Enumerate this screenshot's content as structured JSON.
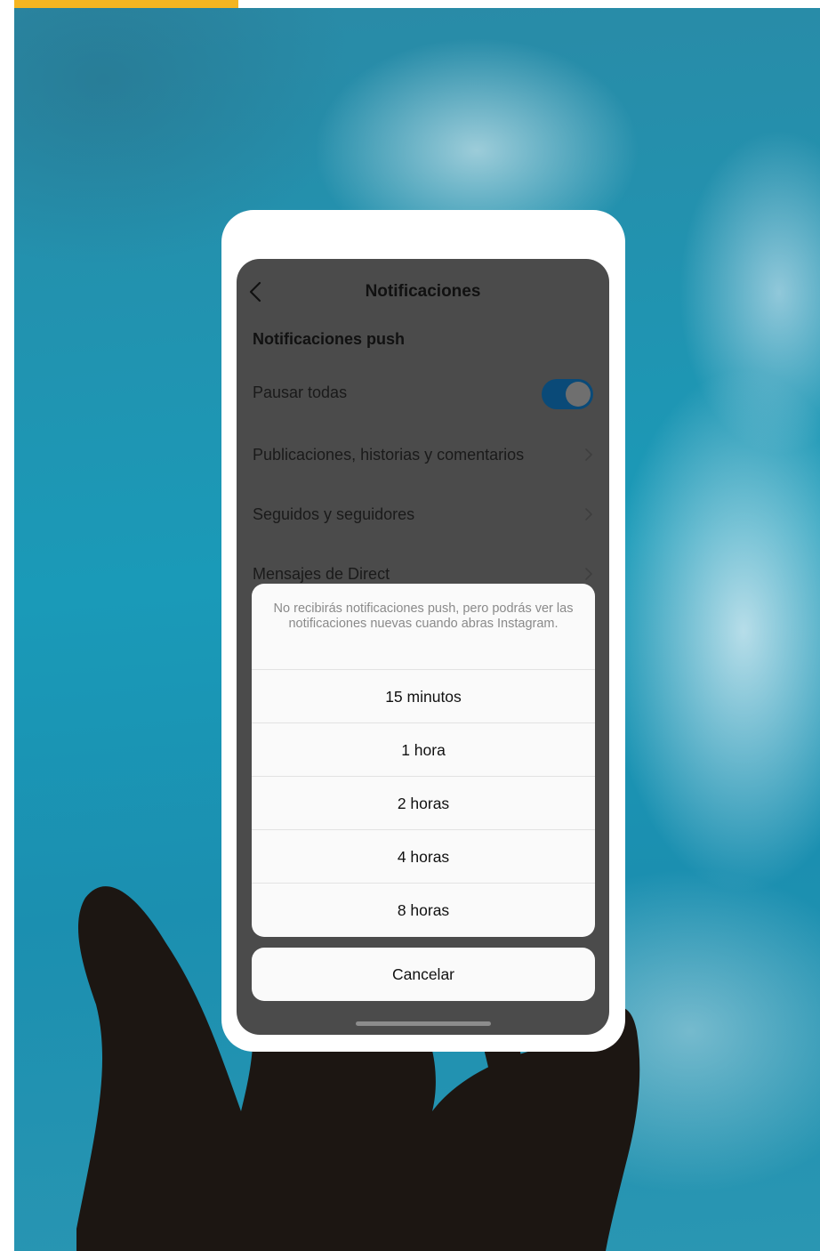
{
  "app": {
    "nav_title": "Notificaciones",
    "section_title": "Notificaciones push"
  },
  "settings": {
    "rows": [
      {
        "label": "Pausar todas",
        "control": "toggle",
        "toggle_on": true
      },
      {
        "label": "Publicaciones, historias y comentarios",
        "control": "chevron"
      },
      {
        "label": "Seguidos y seguidores",
        "control": "chevron"
      },
      {
        "label": "Mensajes de Direct",
        "control": "chevron"
      }
    ]
  },
  "action_sheet": {
    "message": "No recibirás notificaciones push, pero podrás ver las notificaciones nuevas cuando abras Instagram.",
    "options": [
      "15 minutos",
      "1 hora",
      "2 horas",
      "4 horas",
      "8 horas"
    ],
    "cancel_label": "Cancelar"
  },
  "colors": {
    "accent": "#f5b521",
    "toggle_track": "#0a4a78",
    "dim_overlay": "#4b4b4b",
    "sheet_bg": "#fafafa",
    "sky": "#1a9ab8"
  },
  "icons": [
    "back-chevron-icon",
    "chevron-right-icon"
  ]
}
